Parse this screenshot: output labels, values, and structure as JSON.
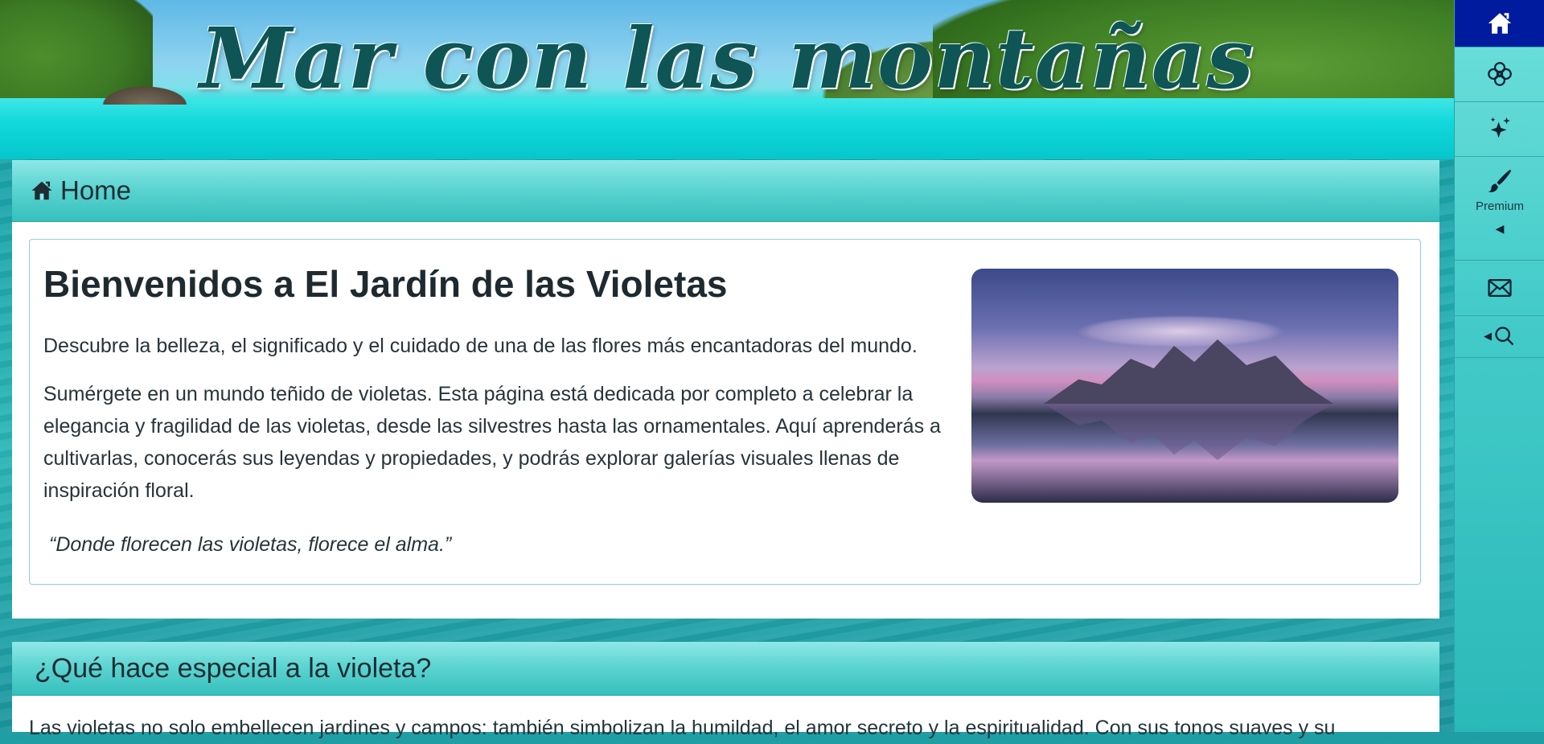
{
  "header": {
    "site_title": "Mar con las montañas"
  },
  "breadcrumb": {
    "icon": "home-icon",
    "label": "Home"
  },
  "welcome": {
    "heading": "Bienvenidos a El Jardín de las Violetas",
    "intro": "Descubre la belleza, el significado y el cuidado de una de las flores más encantadoras del mundo.",
    "body": "Sumérgete en un mundo teñido de violetas. Esta página está dedicada por completo a celebrar la elegancia y fragilidad de las violetas, desde las silvestres hasta las ornamentales. Aquí aprenderás a cultivarlas, conocerás sus leyendas y propiedades, y podrás explorar galerías visuales llenas de inspiración floral.",
    "quote": "“Donde florecen las violetas, florece el alma.”"
  },
  "special": {
    "title": "¿Qué hace especial a la violeta?",
    "text": "Las violetas no solo embellecen jardines y campos: también simbolizan la humildad, el amor secreto y la espiritualidad. Con sus tonos suaves y su"
  },
  "sidebar": {
    "items": [
      {
        "icon": "home-icon",
        "active": true
      },
      {
        "icon": "flower-icon"
      },
      {
        "icon": "sparkle-icon"
      },
      {
        "icon": "brush-icon",
        "label": "Premium"
      },
      {
        "icon": "mail-icon"
      },
      {
        "icon": "search-icon"
      }
    ]
  },
  "colors": {
    "sidebar_active": "#001b9e",
    "title_color": "#0f5555",
    "panel_header": "#5dd5d2"
  }
}
